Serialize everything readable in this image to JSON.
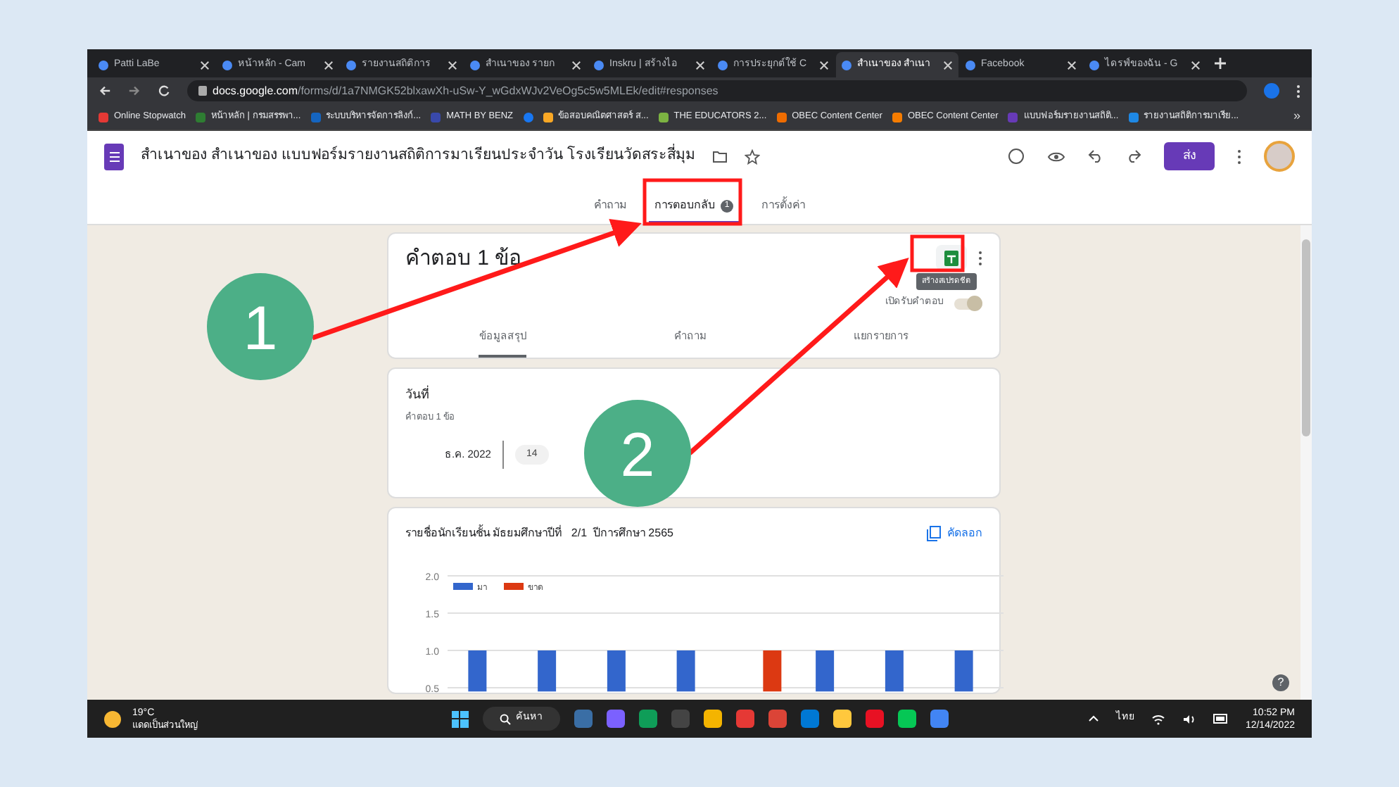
{
  "browser": {
    "tabs": [
      {
        "label": "Patti LaBe",
        "selected": false
      },
      {
        "label": "หน้าหลัก - Cam",
        "selected": false
      },
      {
        "label": "รายงานสถิติการ",
        "selected": false
      },
      {
        "label": "สำเนาของ รายก",
        "selected": false
      },
      {
        "label": "Inskru | สร้างไอ",
        "selected": false
      },
      {
        "label": "การประยุกต์ใช้ C",
        "selected": false
      },
      {
        "label": "สำเนาของ สำเนา",
        "selected": true
      },
      {
        "label": "Facebook",
        "selected": false
      },
      {
        "label": "ไดรฟ์ของฉัน - G",
        "selected": false
      }
    ],
    "url": {
      "host": "docs.google.com",
      "path": "/forms/d/1a7NMGK52blxawXh-uSw-Y_wGdxWJv2VeOg5c5w5MLEk/edit#responses"
    },
    "bookmarks": [
      {
        "label": "Online Stopwatch",
        "color": "#e53935"
      },
      {
        "label": "หน้าหลัก | กรมสรรพา...",
        "color": "#2e7d32"
      },
      {
        "label": "ระบบบริหารจัดการลิงก์...",
        "color": "#1565c0"
      },
      {
        "label": "MATH BY BENZ",
        "color": "#3949ab"
      },
      {
        "color": "#1877f2"
      },
      {
        "label": "ข้อสอบคณิตศาสตร์ ส...",
        "color": "#f9a825"
      },
      {
        "label": "THE EDUCATORS 2...",
        "color": "#7cb342"
      },
      {
        "label": "OBEC Content Center",
        "color": "#ef6c00"
      },
      {
        "label": "OBEC Content Center",
        "color": "#f57c00"
      },
      {
        "label": "แบบฟอร์มรายงานสถิติ...",
        "color": "#673ab7"
      },
      {
        "label": "รายงานสถิติการมาเรีย...",
        "color": "#1e88e5"
      }
    ],
    "more": "»"
  },
  "form": {
    "title": "สำเนาของ สำเนาของ แบบฟอร์มรายงานสถิติการมาเรียนประจำวัน โรงเรียนวัดสระสี่มุม",
    "send": "ส่ง",
    "tabs": [
      {
        "label": "คำถาม",
        "selected": false
      },
      {
        "label": "การตอบกลับ",
        "badge": "1",
        "selected": true
      },
      {
        "label": "การตั้งค่า",
        "selected": false
      }
    ]
  },
  "responses": {
    "heading": "คำตอบ 1 ข้อ",
    "tooltip": "สร้างสเปรดชีต",
    "accepting": {
      "label": "เปิดรับคำตอบ",
      "on": true
    },
    "views": [
      {
        "label": "ข้อมูลสรุป",
        "selected": true
      },
      {
        "label": "คำถาม",
        "selected": false
      },
      {
        "label": "แยกรายการ",
        "selected": false
      }
    ]
  },
  "date_card": {
    "title": "วันที่",
    "count": "คำตอบ 1 ข้อ",
    "month": "ธ.ค. 2022",
    "day": "14"
  },
  "chart_card": {
    "title": "รายชื่อนักเรียนชั้น มัธยมศึกษาปีที่   2/1  ปีการศึกษา 2565",
    "copy": "คัดลอก",
    "chart_data": {
      "type": "bar",
      "grid": true,
      "legend": "top-left",
      "ylim": [
        0.45,
        2
      ],
      "yticks": [
        {
          "value": 0.5,
          "label": "0.5"
        },
        {
          "value": 1,
          "label": "1.0"
        },
        {
          "value": 1.5,
          "label": "1.5"
        },
        {
          "value": 2,
          "label": "2.0"
        }
      ],
      "series": [
        {
          "name": "มา",
          "color": "#3366cc",
          "values": [
            1,
            1,
            1,
            1,
            null,
            1,
            1,
            1
          ]
        },
        {
          "name": "ขาด",
          "color": "#dc3912",
          "values": [
            null,
            null,
            null,
            null,
            1,
            null,
            null,
            null
          ]
        }
      ]
    }
  },
  "help": "?",
  "annotations": [
    {
      "label": "1"
    },
    {
      "label": "2"
    }
  ],
  "taskbar": {
    "temperature": "19°C",
    "weather": "แดดเป็นส่วนใหญ่",
    "search": "ค้นหา",
    "language": "ไทย",
    "time": "10:52 PM",
    "date": "12/14/2022"
  }
}
